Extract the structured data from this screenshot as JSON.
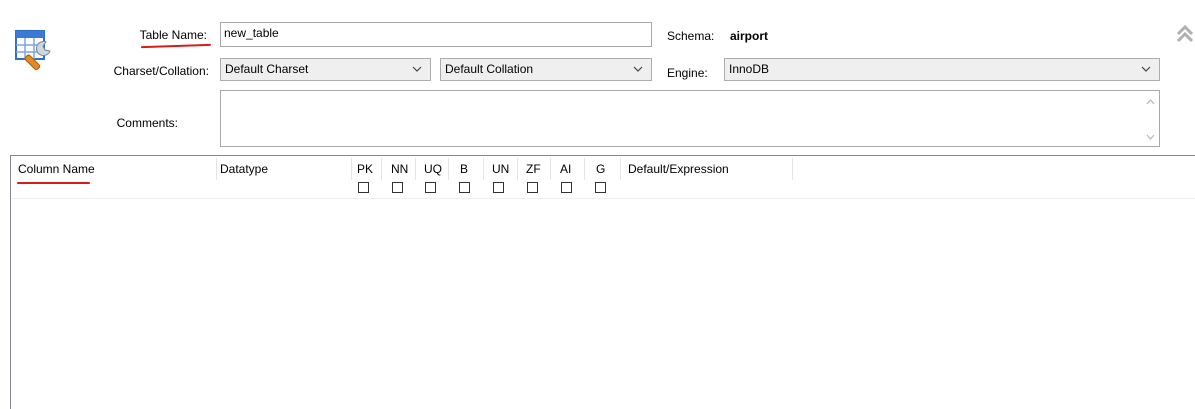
{
  "form": {
    "table_name_label": "Table Name:",
    "table_name_value": "new_table",
    "schema_label": "Schema:",
    "schema_value": "airport",
    "charset_label": "Charset/Collation:",
    "charset_value": "Default Charset",
    "collation_value": "Default Collation",
    "engine_label": "Engine:",
    "engine_value": "InnoDB",
    "comments_label": "Comments:",
    "comments_value": ""
  },
  "columns_grid": {
    "headers": {
      "column_name": "Column Name",
      "datatype": "Datatype",
      "pk": "PK",
      "nn": "NN",
      "uq": "UQ",
      "b": "B",
      "un": "UN",
      "zf": "ZF",
      "ai": "AI",
      "g": "G",
      "default": "Default/Expression"
    },
    "rows": []
  },
  "icons": {
    "table_editor": "table-wrench-icon",
    "collapse": "double-chevron-up-icon"
  },
  "colors": {
    "annotation_underline": "#d81b1b",
    "icon_blue": "#2f6fc9"
  }
}
